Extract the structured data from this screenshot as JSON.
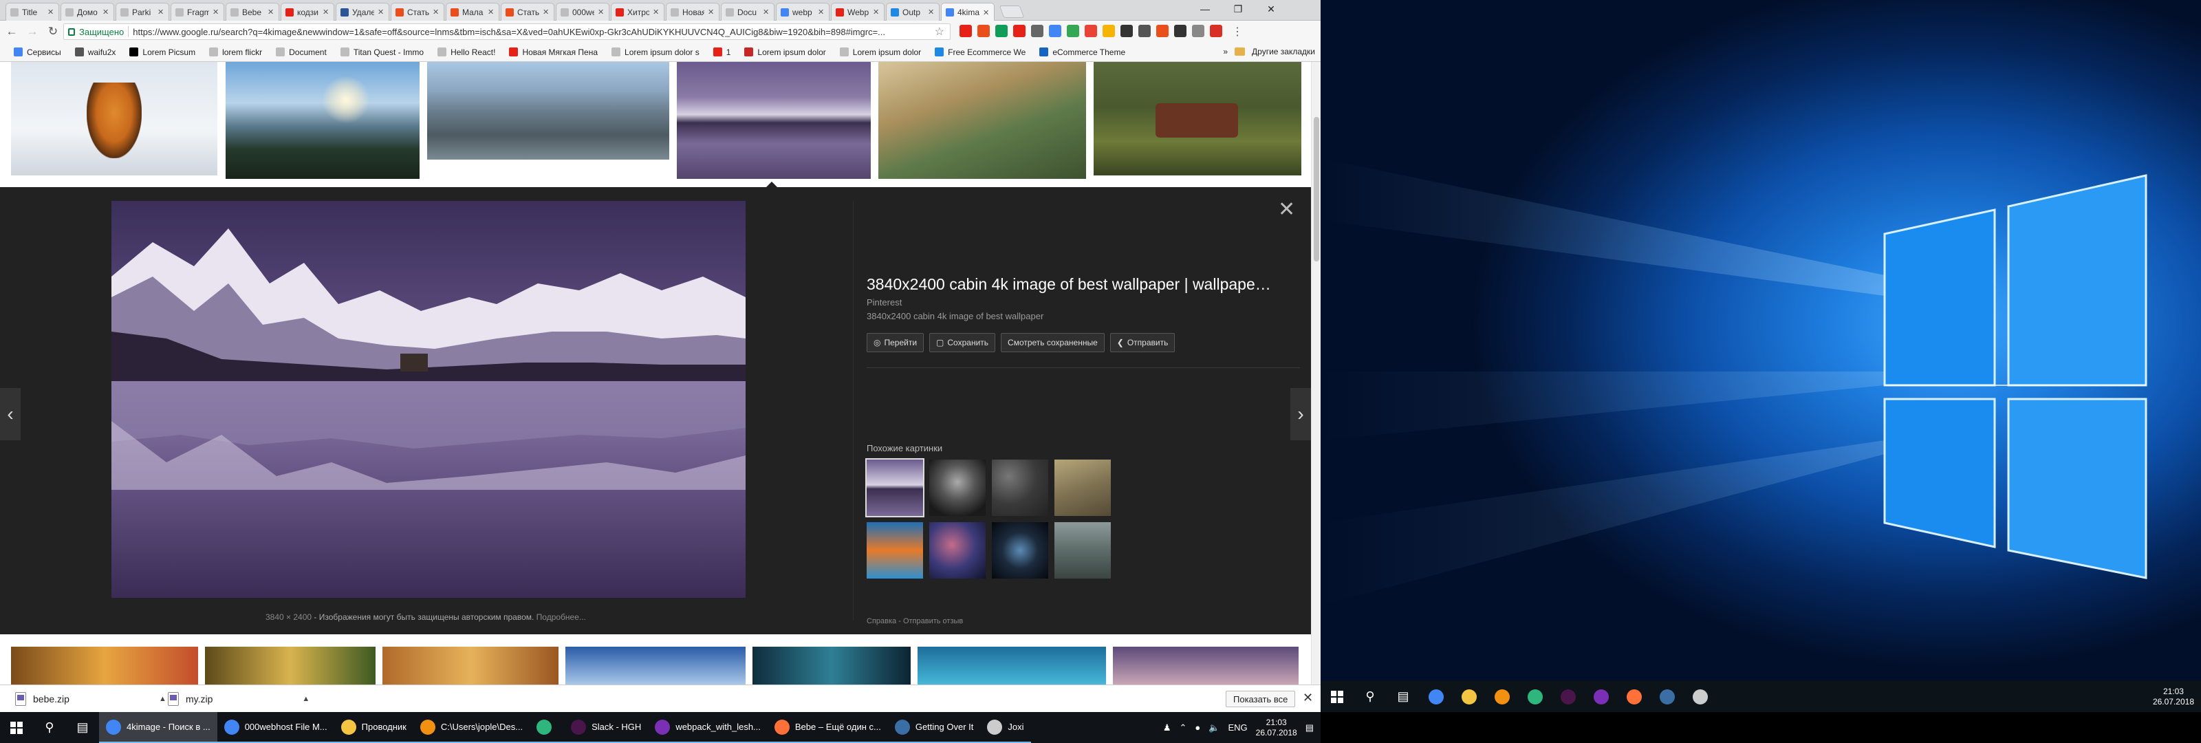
{
  "browser": {
    "tabs": [
      {
        "label": "Title",
        "color": "#bdbdbd"
      },
      {
        "label": "Домо",
        "color": "#bdbdbd"
      },
      {
        "label": "Parki",
        "color": "#bdbdbd"
      },
      {
        "label": "Fragm",
        "color": "#bdbdbd"
      },
      {
        "label": "Bebe",
        "color": "#bdbdbd"
      },
      {
        "label": "кодзи",
        "color": "#e62117"
      },
      {
        "label": "Удале",
        "color": "#2b5797"
      },
      {
        "label": "Статьи",
        "color": "#e94e1b"
      },
      {
        "label": "Мала",
        "color": "#e94e1b"
      },
      {
        "label": "Статьи",
        "color": "#e94e1b"
      },
      {
        "label": "000we",
        "color": "#bdbdbd"
      },
      {
        "label": "Хитро",
        "color": "#e62117"
      },
      {
        "label": "Новая вкл",
        "color": "#bdbdbd"
      },
      {
        "label": "Docu",
        "color": "#bdbdbd"
      },
      {
        "label": "webp",
        "color": "#4285f4"
      },
      {
        "label": "Webp",
        "color": "#e62117"
      },
      {
        "label": "Outp",
        "color": "#1e88e5"
      },
      {
        "label": "4kima",
        "color": "#4285f4"
      }
    ],
    "active_tab_index": 17,
    "secure_label": "Защищено",
    "url": "https://www.google.ru/search?q=4kimage&newwindow=1&safe=off&source=lnms&tbm=isch&sa=X&ved=0ahUKEwi0xp-Gkr3cAhUDiKYKHUUVCN4Q_AUICig8&biw=1920&bih=898#imgrc=...",
    "extensions": [
      "#e62117",
      "#e94e1b",
      "#0f9d58",
      "#e62117",
      "#666666",
      "#4285f4",
      "#34a853",
      "#ea4335",
      "#f4b400",
      "#333333",
      "#555555",
      "#e94e1b",
      "#333333",
      "#888888",
      "#d93025"
    ],
    "bookmarks": [
      {
        "label": "Сервисы",
        "color": "#4285f4"
      },
      {
        "label": "waifu2x",
        "color": "#555555"
      },
      {
        "label": "Lorem Picsum",
        "color": "#000000"
      },
      {
        "label": "lorem flickr",
        "color": "#bdbdbd"
      },
      {
        "label": "Document",
        "color": "#bdbdbd"
      },
      {
        "label": "Titan Quest - Immo",
        "color": "#bdbdbd"
      },
      {
        "label": "Hello React!",
        "color": "#bdbdbd"
      },
      {
        "label": "Новая Мягкая Пена",
        "color": "#e62117"
      },
      {
        "label": "Lorem ipsum dolor s",
        "color": "#bdbdbd"
      },
      {
        "label": "1",
        "color": "#e62117"
      },
      {
        "label": "Lorem ipsum dolor",
        "color": "#c62828"
      },
      {
        "label": "Lorem ipsum dolor",
        "color": "#bdbdbd"
      },
      {
        "label": "Free Ecommerce We",
        "color": "#1e88e5"
      },
      {
        "label": "eCommerce Theme",
        "color": "#1565c0"
      }
    ],
    "other_bookmarks": "Другие закладки",
    "more_bookmarks": "»"
  },
  "preview": {
    "title": "3840x2400 cabin 4k image of best wallpaper | wallpape…",
    "source": "Pinterest",
    "description": "3840x2400 cabin 4k image of best wallpaper",
    "actions": [
      {
        "label": "Перейти",
        "icon": "globe-icon"
      },
      {
        "label": "Сохранить",
        "icon": "bookmark-icon"
      },
      {
        "label": "Смотреть сохраненные",
        "icon": ""
      },
      {
        "label": "Отправить",
        "icon": "share-icon"
      }
    ],
    "similar_label": "Похожие картинки",
    "footer_dims": "3840 × 2400",
    "footer_copyright": " - Изображения могут быть защищены авторским правом.",
    "footer_more": "Подробнее...",
    "footer_help": "Справка",
    "footer_feedback": "Отправить отзыв",
    "footer_sep": " - "
  },
  "downloads": [
    {
      "name": "bebe.zip"
    },
    {
      "name": "my.zip"
    }
  ],
  "downloads_show_all": "Показать все",
  "taskbar_left": {
    "apps": [
      {
        "label": "4kimage - Поиск в ...",
        "color": "#4285f4",
        "state": "active"
      },
      {
        "label": "000webhost File M...",
        "color": "#4285f4",
        "state": "running"
      },
      {
        "label": "Проводник",
        "color": "#f4c542",
        "state": "running"
      },
      {
        "label": "C:\\Users\\jople\\Des...",
        "color": "#f29111",
        "state": "running"
      },
      {
        "label": "",
        "color": "#2eb67d",
        "state": "running"
      },
      {
        "label": "Slack - HGH",
        "color": "#4a154b",
        "state": "running"
      },
      {
        "label": "webpack_with_lesh...",
        "color": "#7b2fb5",
        "state": "running"
      },
      {
        "label": "Bebe – Ещё один с...",
        "color": "#ff7139",
        "state": "running"
      },
      {
        "label": "Getting Over It",
        "color": "#3a6ea5",
        "state": "running"
      },
      {
        "label": "Joxi",
        "color": "#cccccc",
        "state": "running"
      }
    ],
    "lang": "ENG",
    "time": "21:03",
    "date": "26.07.2018"
  },
  "taskbar_right": {
    "time": "21:03",
    "date": "26.07.2018",
    "pinned": [
      "#4285f4",
      "#f4c542",
      "#f29111",
      "#2eb67d",
      "#4a154b",
      "#7b2fb5",
      "#ff7139",
      "#3a6ea5",
      "#cccccc"
    ]
  },
  "colors": {
    "preview_bg": "#222222",
    "accent": "#76b9ed",
    "secure": "#0b8043"
  }
}
